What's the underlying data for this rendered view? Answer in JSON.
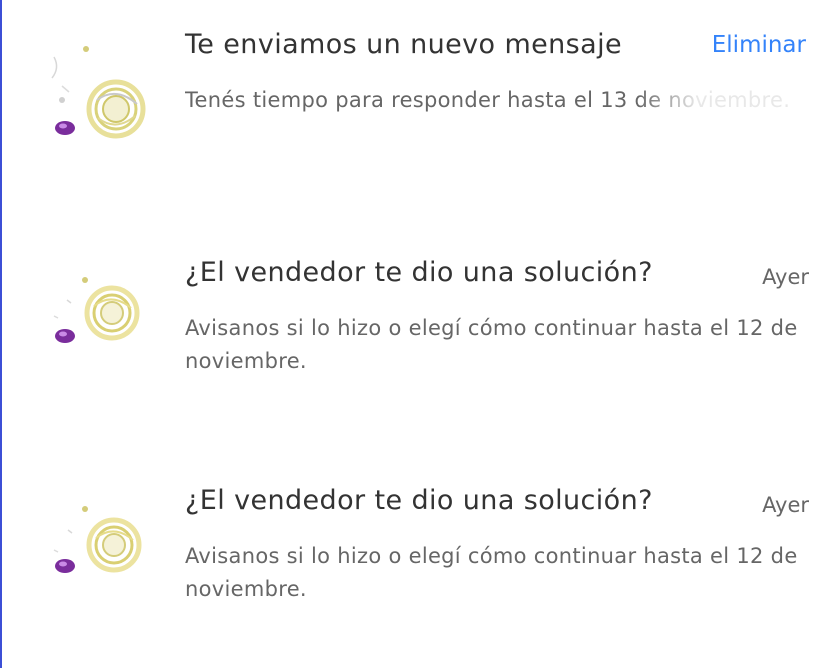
{
  "notifications": [
    {
      "title": "Te enviamos un nuevo mensaje",
      "action": "Eliminar",
      "body": "Tenés tiempo para responder hasta el 13 de noviembre."
    },
    {
      "title": "¿El vendedor te dio una solución?",
      "time": "Ayer",
      "body": "Avisanos si lo hizo o elegí cómo continuar hasta el 12 de noviembre."
    },
    {
      "title": "¿El vendedor te dio una solución?",
      "time": "Ayer",
      "body": "Avisanos si lo hizo o elegí cómo continuar hasta el 12 de noviembre."
    }
  ],
  "colors": {
    "link": "#3483fa",
    "title": "#333333",
    "body": "#666666",
    "edge": "#3c4fd6"
  },
  "icons": {
    "thumbnail": "ring-jewelry-thumbnail-icon",
    "badge": "purple-gem-badge-icon"
  }
}
